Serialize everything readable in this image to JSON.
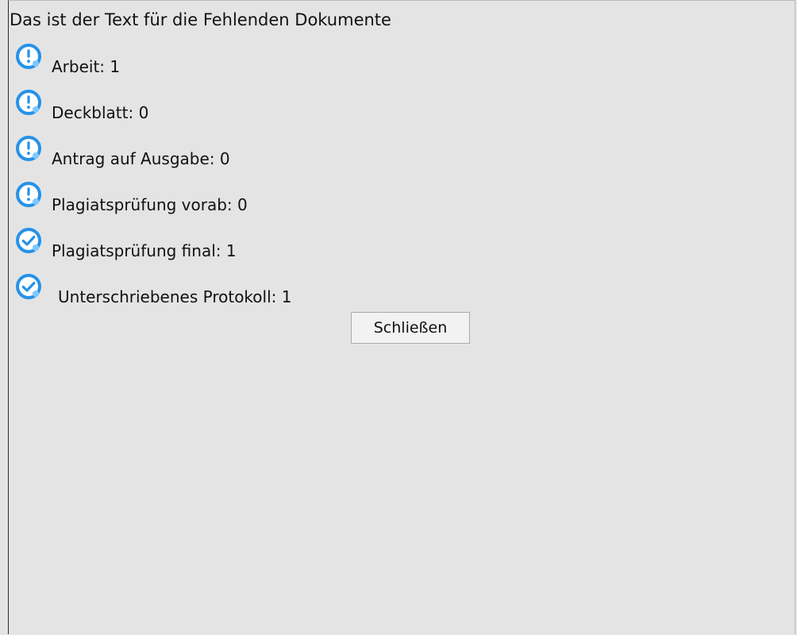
{
  "dialog": {
    "message": "Das ist der Text für die Fehlenden Dokumente",
    "close_label": "Schließen"
  },
  "documents": [
    {
      "label": "Arbeit: 1",
      "status": "warning",
      "icon": "exclamation-icon"
    },
    {
      "label": "Deckblatt: 0",
      "status": "warning",
      "icon": "exclamation-icon"
    },
    {
      "label": "Antrag auf Ausgabe: 0",
      "status": "warning",
      "icon": "exclamation-icon"
    },
    {
      "label": "Plagiatsprüfung vorab: 0",
      "status": "warning",
      "icon": "exclamation-icon"
    },
    {
      "label": "Plagiatsprüfung final: 1",
      "status": "ok",
      "icon": "checkmark-icon"
    },
    {
      "label": "Unterschriebenes Protokoll: 1",
      "status": "ok",
      "icon": "checkmark-icon"
    }
  ],
  "colors": {
    "background": "#e4e4e4",
    "icon_blue": "#1d8fe0",
    "icon_ring": "#59b8f5"
  }
}
